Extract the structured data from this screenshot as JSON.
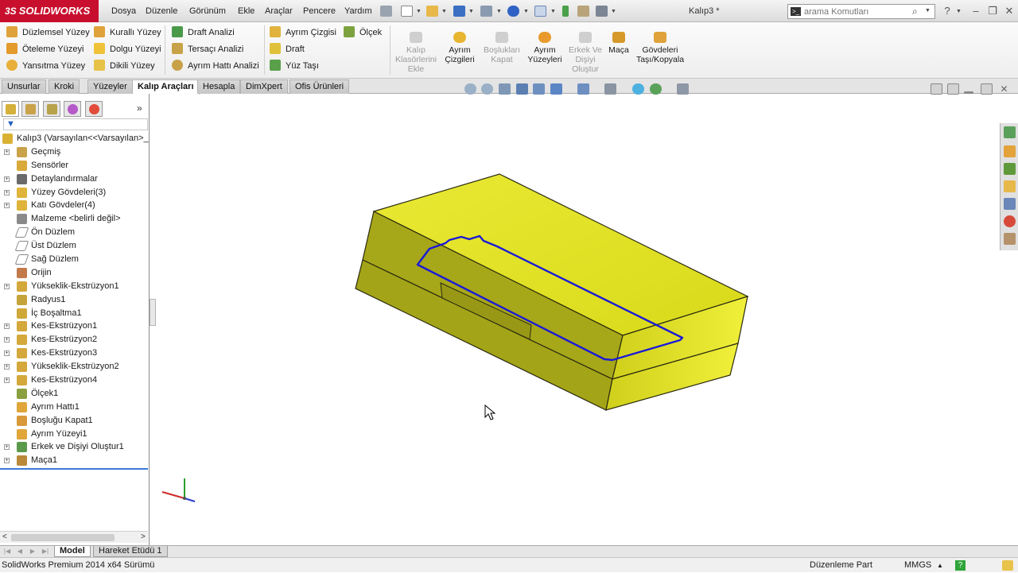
{
  "app": {
    "logo_text": "SOLIDWORKS",
    "logo_prefix": "3S",
    "document_title": "Kalıp3 *"
  },
  "menu": [
    "Dosya",
    "Düzenle",
    "Görünüm",
    "Ekle",
    "Araçlar",
    "Pencere",
    "Yardım"
  ],
  "search": {
    "placeholder": "arama Komutları"
  },
  "ribbon": {
    "col1": [
      "Düzlemsel Yüzey",
      "Öteleme Yüzeyi",
      "Yansıtma Yüzey"
    ],
    "col2": [
      "Kurallı Yüzey",
      "Dolgu Yüzeyi",
      "Dikili Yüzey"
    ],
    "col3": [
      "Draft Analizi",
      "Tersaçı Analizi",
      "Ayrım Hattı Analizi"
    ],
    "col4": [
      "Ayrım Çizgisi",
      "Draft",
      "Yüz Taşı"
    ],
    "col5": [
      "Ölçek"
    ],
    "large": [
      {
        "label": "Kalıp Klasörlerini Ekle",
        "disabled": true
      },
      {
        "label": "Ayrım Çizgileri",
        "disabled": false
      },
      {
        "label": "Boşlukları Kapat",
        "disabled": true
      },
      {
        "label": "Ayrım Yüzeyleri",
        "disabled": false
      },
      {
        "label": "Erkek Ve Dişiyi Oluştur",
        "disabled": true
      },
      {
        "label": "Maça",
        "disabled": false
      },
      {
        "label": "Gövdeleri Taşı/Kopyala",
        "disabled": false
      }
    ]
  },
  "tabs": [
    "Unsurlar",
    "Kroki",
    "Yüzeyler",
    "Kalıp Araçları",
    "Hesapla",
    "DimXpert",
    "Ofis Ürünleri"
  ],
  "active_tab": "Kalıp Araçları",
  "tree": {
    "root": "Kalıp3  (Varsayılan<<Varsayılan>_",
    "items": [
      {
        "label": "Geçmiş",
        "icon": "history-icon",
        "expand": true
      },
      {
        "label": "Sensörler",
        "icon": "sensor-icon",
        "expand": false
      },
      {
        "label": "Detaylandırmalar",
        "icon": "annotations-icon",
        "expand": true
      },
      {
        "label": "Yüzey Gövdeleri(3)",
        "icon": "surface-bodies-icon",
        "expand": true
      },
      {
        "label": "Katı Gövdeler(4)",
        "icon": "solid-bodies-icon",
        "expand": true
      },
      {
        "label": "Malzeme <belirli değil>",
        "icon": "material-icon",
        "expand": false
      },
      {
        "label": "Ön Düzlem",
        "icon": "plane-icon",
        "expand": false
      },
      {
        "label": "Üst Düzlem",
        "icon": "plane-icon",
        "expand": false
      },
      {
        "label": "Sağ Düzlem",
        "icon": "plane-icon",
        "expand": false
      },
      {
        "label": "Orijin",
        "icon": "origin-icon",
        "expand": false
      },
      {
        "label": "Yükseklik-Ekstrüzyon1",
        "icon": "extrude-icon",
        "expand": true
      },
      {
        "label": "Radyus1",
        "icon": "fillet-icon",
        "expand": false
      },
      {
        "label": "İç Boşaltma1",
        "icon": "shell-icon",
        "expand": false
      },
      {
        "label": "Kes-Ekstrüzyon1",
        "icon": "cut-extrude-icon",
        "expand": true
      },
      {
        "label": "Kes-Ekstrüzyon2",
        "icon": "cut-extrude-icon",
        "expand": true
      },
      {
        "label": "Kes-Ekstrüzyon3",
        "icon": "cut-extrude-icon",
        "expand": true
      },
      {
        "label": "Yükseklik-Ekstrüzyon2",
        "icon": "extrude-icon",
        "expand": true
      },
      {
        "label": "Kes-Ekstrüzyon4",
        "icon": "cut-extrude-icon",
        "expand": true
      },
      {
        "label": "Ölçek1",
        "icon": "scale-icon",
        "expand": false
      },
      {
        "label": "Ayrım Hattı1",
        "icon": "parting-line-icon",
        "expand": false
      },
      {
        "label": "Boşluğu Kapat1",
        "icon": "shut-off-icon",
        "expand": false
      },
      {
        "label": "Ayrım Yüzeyi1",
        "icon": "parting-surface-icon",
        "expand": false
      },
      {
        "label": "Erkek ve Dişiyi Oluştur1",
        "icon": "tooling-split-icon",
        "expand": true
      },
      {
        "label": "Maça1",
        "icon": "core-icon",
        "expand": true
      }
    ]
  },
  "bottom_tabs": [
    "Model",
    "Hareket Etüdü 1"
  ],
  "status": {
    "version": "SolidWorks Premium 2014 x64 Sürümü",
    "mode": "Düzenleme Part",
    "units": "MMGS",
    "units_arrow": "▲"
  },
  "colors": {
    "brand": "#c8102e",
    "model_yellow": "#e6e600",
    "parting_line": "#1a1ad6"
  }
}
